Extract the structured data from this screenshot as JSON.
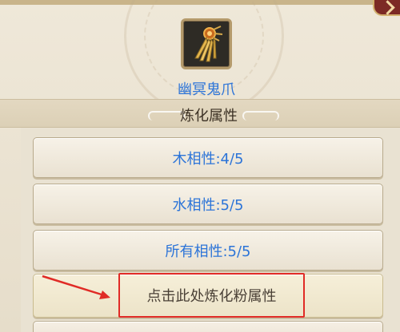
{
  "item": {
    "name": "幽冥鬼爪",
    "icon": "golden-claw-icon"
  },
  "section": {
    "title": "炼化属性"
  },
  "attributes": [
    {
      "label": "木相性:4/5"
    },
    {
      "label": "水相性:5/5"
    },
    {
      "label": "所有相性:5/5"
    }
  ],
  "action": {
    "label": "点击此处炼化粉属性"
  },
  "colors": {
    "accent_text": "#2c74d8",
    "highlight": "#e02b26",
    "panel_bg": "#e9e1d0"
  }
}
